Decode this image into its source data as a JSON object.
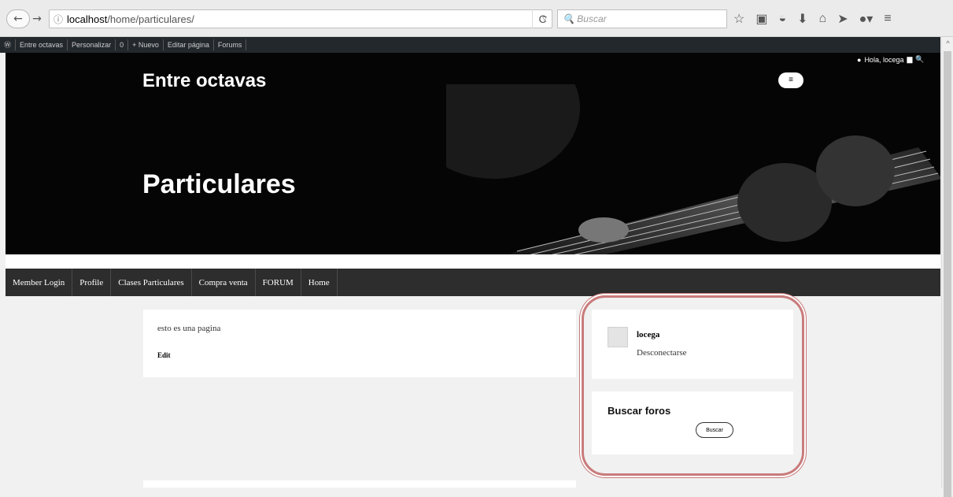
{
  "browser": {
    "url_host": "localhost",
    "url_path": "/home/particulares/",
    "search_placeholder": "Buscar",
    "url_info": "ⓘ",
    "url_dropdown": "▿",
    "reload": "C",
    "icons": [
      "star-icon",
      "clipboard-icon",
      "pocket-icon",
      "download-icon",
      "home-icon",
      "send-icon",
      "adblock-icon",
      "menu-icon"
    ]
  },
  "admin_bar": {
    "items": [
      "Entre octavas",
      "Personalizar",
      "0",
      "+ Nuevo",
      "Editar página",
      "Forums"
    ]
  },
  "hero": {
    "site_title": "Entre octavas",
    "page_title": "Particulares",
    "greeting": "Hola, locega",
    "menu_toggle": "≡"
  },
  "nav": {
    "items": [
      "Member Login",
      "Profile",
      "Clases Particulares",
      "Compra venta",
      "FORUM",
      "Home"
    ]
  },
  "content": {
    "text": "esto es una pagina",
    "edit": "Edit"
  },
  "sidebar": {
    "username": "locega",
    "logout": "Desconectarse",
    "search_title": "Buscar foros",
    "search_button": "Buscar"
  }
}
